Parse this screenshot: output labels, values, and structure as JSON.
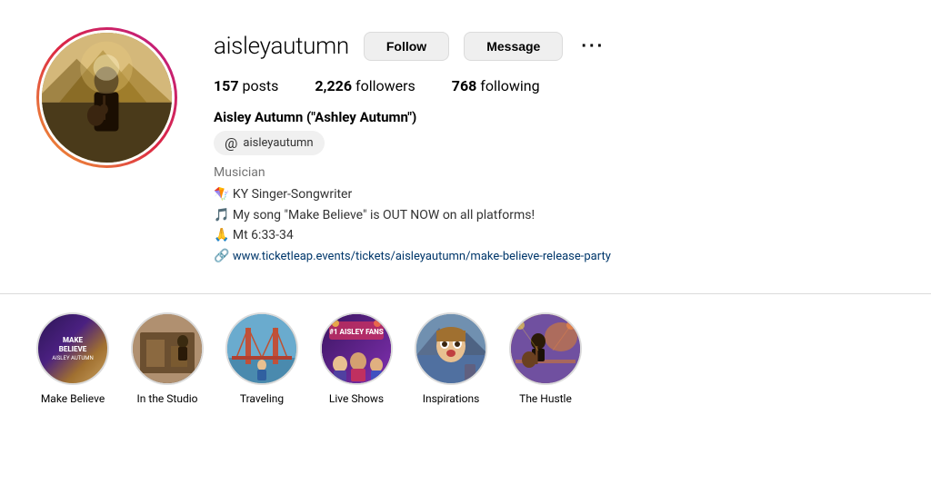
{
  "profile": {
    "username": "aisleyautumn",
    "full_name": "Aisley Autumn (\"Ashley Autumn\")",
    "threads_handle": "aisleyautumn",
    "category": "Musician",
    "bio_lines": [
      "🪁 KY Singer-Songwriter",
      "🎵 My song \"Make Believe\" is OUT NOW on all platforms!",
      "🙏 Mt 6:33-34"
    ],
    "link": "www.ticketleap.events/tickets/aisleyautumn/make-believe-release-party",
    "link_full": "https://www.ticketleap.events/tickets/aisleyautumn/make-believe-release-party",
    "stats": {
      "posts": "157",
      "posts_label": "posts",
      "followers": "2,226",
      "followers_label": "followers",
      "following": "768",
      "following_label": "following"
    },
    "buttons": {
      "follow": "Follow",
      "message": "Message",
      "more": "···"
    }
  },
  "highlights": [
    {
      "id": "make-believe",
      "label": "Make Believe",
      "bg": "make-believe",
      "inner_text": "MAKE BELIEVE\nAISLEY AUTUMN"
    },
    {
      "id": "studio",
      "label": "In the Studio",
      "bg": "studio",
      "inner_text": ""
    },
    {
      "id": "traveling",
      "label": "Traveling",
      "bg": "traveling",
      "inner_text": ""
    },
    {
      "id": "live-shows",
      "label": "Live Shows",
      "bg": "live",
      "inner_text": "#1 AISLEY FANS"
    },
    {
      "id": "inspirations",
      "label": "Inspirations",
      "bg": "inspirations",
      "inner_text": ""
    },
    {
      "id": "hustle",
      "label": "The Hustle",
      "bg": "hustle",
      "inner_text": ""
    }
  ]
}
